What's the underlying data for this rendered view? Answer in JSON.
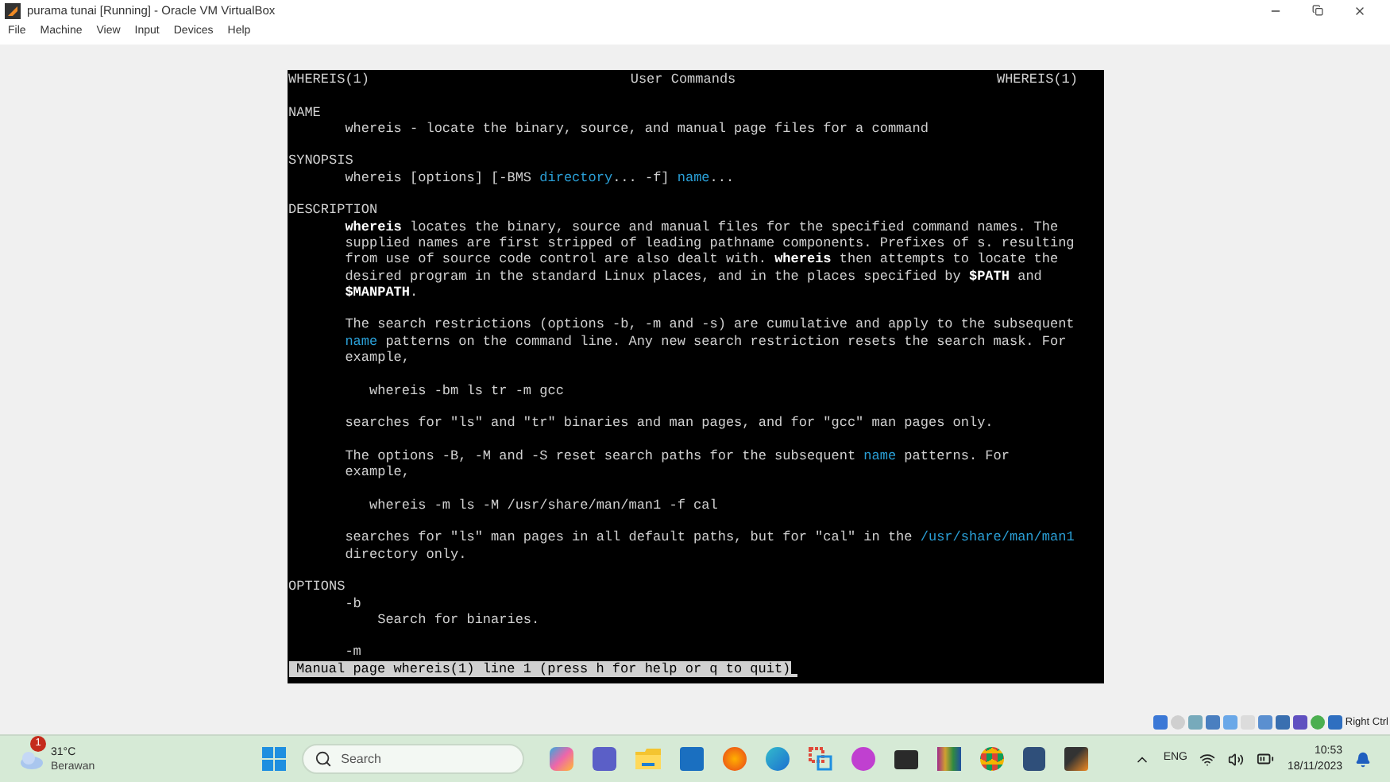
{
  "window": {
    "title": "purama tunai [Running] - Oracle VM VirtualBox"
  },
  "menu": [
    "File",
    "Machine",
    "View",
    "Input",
    "Devices",
    "Help"
  ],
  "terminal": {
    "header": {
      "left": "WHEREIS(1)",
      "center": "User Commands",
      "right": "WHEREIS(1)"
    },
    "lines": [
      {
        "kind": "blank"
      },
      {
        "kind": "text",
        "segments": [
          {
            "kind": "plain",
            "text": "NAME"
          }
        ]
      },
      {
        "kind": "text",
        "segments": [
          {
            "kind": "plain",
            "text": "       whereis - locate the binary, source, and manual page files for a command"
          }
        ]
      },
      {
        "kind": "blank"
      },
      {
        "kind": "text",
        "segments": [
          {
            "kind": "plain",
            "text": "SYNOPSIS"
          }
        ]
      },
      {
        "kind": "text",
        "segments": [
          {
            "kind": "plain",
            "text": "       whereis [options] [-BMS "
          },
          {
            "kind": "link",
            "text": "directory"
          },
          {
            "kind": "plain",
            "text": "... -f] "
          },
          {
            "kind": "link",
            "text": "name"
          },
          {
            "kind": "plain",
            "text": "..."
          }
        ]
      },
      {
        "kind": "blank"
      },
      {
        "kind": "text",
        "segments": [
          {
            "kind": "plain",
            "text": "DESCRIPTION"
          }
        ]
      },
      {
        "kind": "indented",
        "segments": [
          {
            "kind": "bold",
            "text": "whereis"
          },
          {
            "kind": "plain",
            "text": " locates the binary, source and manual files for the specified command names. The"
          }
        ]
      },
      {
        "kind": "text",
        "segments": [
          {
            "kind": "plain",
            "text": "       supplied names are first stripped of leading pathname components. Prefixes of s. resulting"
          }
        ]
      },
      {
        "kind": "text",
        "segments": [
          {
            "kind": "plain",
            "text": "       from use of source code control are also dealt with. "
          },
          {
            "kind": "bold",
            "text": "whereis"
          },
          {
            "kind": "plain",
            "text": " then attempts to locate the"
          }
        ]
      },
      {
        "kind": "text",
        "segments": [
          {
            "kind": "plain",
            "text": "       desired program in the standard Linux places, and in the places specified by "
          },
          {
            "kind": "bold",
            "text": "$PATH"
          },
          {
            "kind": "plain",
            "text": " and"
          }
        ]
      },
      {
        "kind": "indented",
        "segments": [
          {
            "kind": "bold",
            "text": "$MANPATH"
          },
          {
            "kind": "plain",
            "text": "."
          }
        ]
      },
      {
        "kind": "blank"
      },
      {
        "kind": "text",
        "segments": [
          {
            "kind": "plain",
            "text": "       The search restrictions (options -b, -m and -s) are cumulative and apply to the subsequent"
          }
        ]
      },
      {
        "kind": "indented",
        "segments": [
          {
            "kind": "link",
            "text": "name"
          },
          {
            "kind": "plain",
            "text": " patterns on the command line. Any new search restriction resets the search mask. For"
          }
        ]
      },
      {
        "kind": "text",
        "segments": [
          {
            "kind": "plain",
            "text": "       example,"
          }
        ]
      },
      {
        "kind": "blank"
      },
      {
        "kind": "text",
        "segments": [
          {
            "kind": "plain",
            "text": "          whereis -bm ls tr -m gcc"
          }
        ]
      },
      {
        "kind": "blank"
      },
      {
        "kind": "text",
        "segments": [
          {
            "kind": "plain",
            "text": "       searches for \"ls\" and \"tr\" binaries and man pages, and for \"gcc\" man pages only."
          }
        ]
      },
      {
        "kind": "blank"
      },
      {
        "kind": "text",
        "segments": [
          {
            "kind": "plain",
            "text": "       The options -B, -M and -S reset search paths for the subsequent "
          },
          {
            "kind": "link",
            "text": "name"
          },
          {
            "kind": "plain",
            "text": " patterns. For"
          }
        ]
      },
      {
        "kind": "text",
        "segments": [
          {
            "kind": "plain",
            "text": "       example,"
          }
        ]
      },
      {
        "kind": "blank"
      },
      {
        "kind": "text",
        "segments": [
          {
            "kind": "plain",
            "text": "          whereis -m ls -M /usr/share/man/man1 -f cal"
          }
        ]
      },
      {
        "kind": "blank"
      },
      {
        "kind": "text",
        "segments": [
          {
            "kind": "plain",
            "text": "       searches for \"ls\" man pages in all default paths, but for \"cal\" in the "
          },
          {
            "kind": "link",
            "text": "/usr/share/man/man1"
          }
        ]
      },
      {
        "kind": "text",
        "segments": [
          {
            "kind": "plain",
            "text": "       directory only."
          }
        ]
      },
      {
        "kind": "blank"
      },
      {
        "kind": "text",
        "segments": [
          {
            "kind": "plain",
            "text": "OPTIONS"
          }
        ]
      },
      {
        "kind": "text",
        "segments": [
          {
            "kind": "plain",
            "text": "       -b"
          }
        ]
      },
      {
        "kind": "text",
        "segments": [
          {
            "kind": "plain",
            "text": "           Search for binaries."
          }
        ]
      },
      {
        "kind": "blank"
      },
      {
        "kind": "text",
        "segments": [
          {
            "kind": "plain",
            "text": "       -m"
          }
        ]
      }
    ],
    "status": "Manual page whereis(1) line 1 (press h for help or q to quit)"
  },
  "host_key": "Right Ctrl",
  "taskbar": {
    "weather": {
      "badge": "1",
      "temperature": "31°C",
      "condition": "Berawan"
    },
    "search": {
      "placeholder": "Search"
    },
    "language": "ENG",
    "time": "10:53",
    "date": "18/11/2023"
  }
}
